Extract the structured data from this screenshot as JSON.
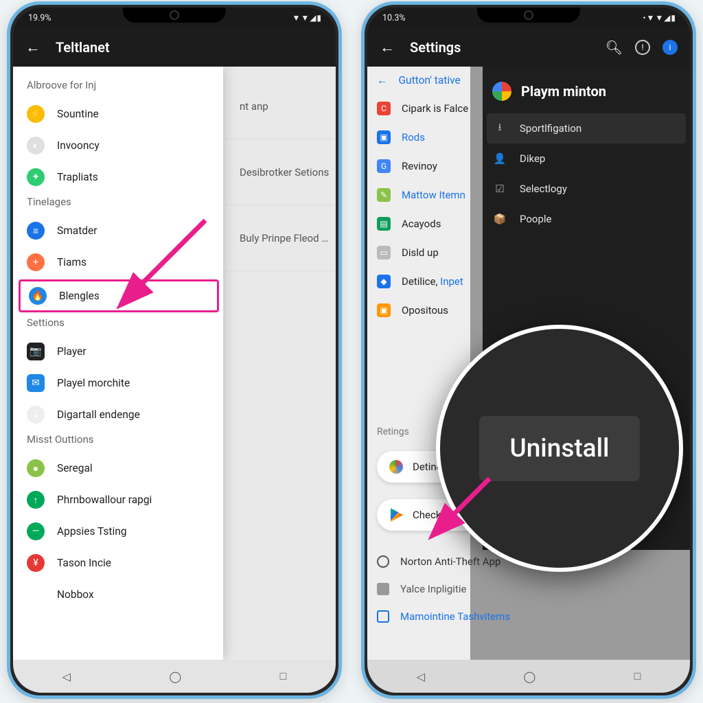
{
  "left": {
    "status_time": "19.9%",
    "title": "Teltlanet",
    "bg_rows": [
      "",
      "nt anp",
      "Desibrotker Setions",
      "Buly Prinpe Fleod …"
    ],
    "drawer": {
      "sections": [
        {
          "head": "Albroove for Inj",
          "items": [
            {
              "label": "Sountine",
              "bg": "#fbbc04",
              "glyph": "⚡"
            },
            {
              "label": "Invooncy",
              "bg": "#e0e0e0",
              "glyph": "◐"
            },
            {
              "label": "Trapliats",
              "bg": "#2ecc71",
              "glyph": "✦"
            }
          ]
        },
        {
          "head": "Tinelages",
          "items": [
            {
              "label": "Smatder",
              "bg": "#1a73e8",
              "glyph": "≡"
            },
            {
              "label": "Tiams",
              "bg": "#ff7043",
              "glyph": "+"
            },
            {
              "label": "Blengles",
              "bg": "#1e88e5",
              "glyph": "🔥",
              "hl": true
            }
          ]
        },
        {
          "head": "Settions",
          "items": [
            {
              "label": "Player",
              "bg": "#222",
              "glyph": "📷",
              "square": true
            },
            {
              "label": "Playel morchite",
              "bg": "#1e88e5",
              "glyph": "✉",
              "square": true
            },
            {
              "label": "Digartall endenge",
              "bg": "#eee",
              "glyph": "⇣"
            }
          ]
        },
        {
          "head": "Misst Outtions",
          "items": [
            {
              "label": "Seregal",
              "bg": "#8bc34a",
              "glyph": "●"
            },
            {
              "label": "Phrnbowallour rapgi",
              "bg": "#00a85a",
              "glyph": "↑"
            },
            {
              "label": "Appsies Tsting",
              "bg": "#00a85a",
              "glyph": "—"
            },
            {
              "label": "Tason Incie",
              "bg": "#e53935",
              "glyph": "¥"
            },
            {
              "label": "Nobbox",
              "bg": "#fff",
              "glyph": "○"
            }
          ]
        }
      ]
    }
  },
  "right": {
    "status_time": "10.3%",
    "title": "Settings",
    "subhead": "Gutton' tative",
    "rows": [
      {
        "label": "Cipark is Falce",
        "bg": "#ea4335",
        "glyph": "C"
      },
      {
        "label": "Rods",
        "bg": "#1a73e8",
        "glyph": "▣",
        "link": true
      },
      {
        "label": "Revinoy",
        "bg": "#4285f4",
        "glyph": "G"
      },
      {
        "label": "Mattow Itemn",
        "bg": "#8bc34a",
        "glyph": "✎",
        "link": true
      },
      {
        "label": "Acayods",
        "bg": "#0f9d58",
        "glyph": "▤"
      },
      {
        "label": "Disld up",
        "bg": "#bbb",
        "glyph": "▭"
      },
      {
        "label": "Detilice, Inpet",
        "bg": "#1a73e8",
        "glyph": "◆",
        "mixed": true
      },
      {
        "label": "Opositous",
        "bg": "#ff9800",
        "glyph": "▣"
      }
    ],
    "panel": {
      "title": "Playm minton",
      "items": [
        {
          "label": "Sportlfigation",
          "glyph": "⭳",
          "sel": true
        },
        {
          "label": "Dikep",
          "glyph": "👤"
        },
        {
          "label": "Selectlogy",
          "glyph": "☑"
        },
        {
          "label": "Poople",
          "glyph": "📦"
        }
      ]
    },
    "zoom_label": "Uninstall",
    "ratings_head": "Retings",
    "chip1": "Detinot Ust",
    "chip2": "Checkde Premure",
    "plain1": "Norton Anti-Theft App",
    "plain2": "Yalce Inpligitie",
    "plain3": "Mamointine Tashvitems"
  }
}
